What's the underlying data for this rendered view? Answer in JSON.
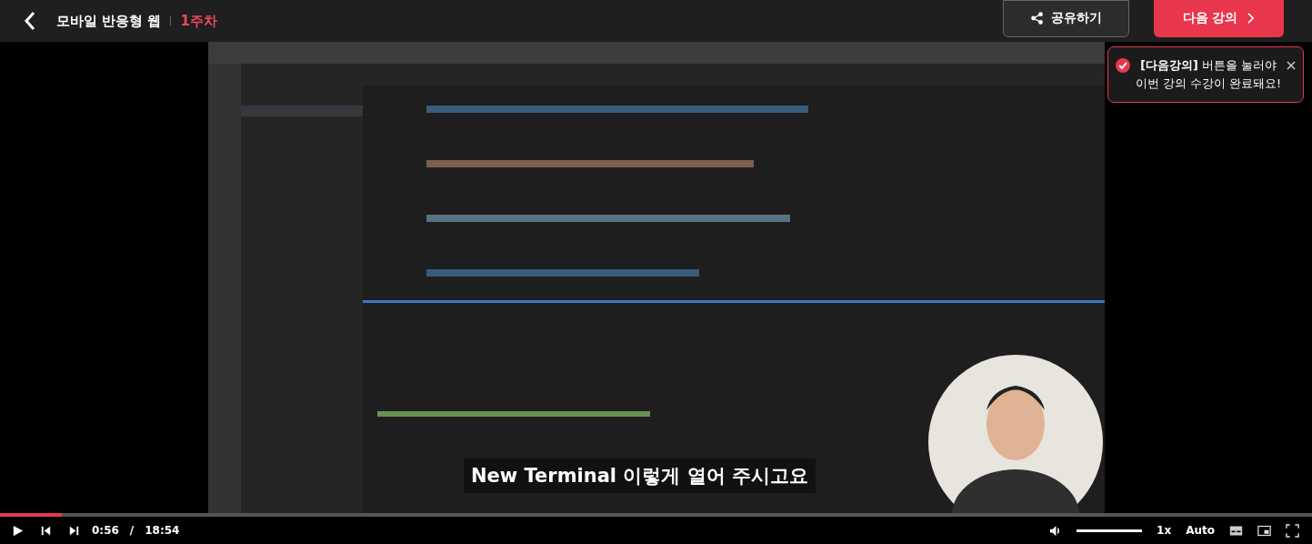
{
  "header": {
    "course": "모바일 반응형 웹",
    "section": "1주차",
    "share_button": "공유하기",
    "next_button": "다음 강의"
  },
  "toast": {
    "bold": "[다음강의]",
    "message": "버튼을 눌러야 이번 강의 수강이 완료돼요!"
  },
  "video": {
    "subtitle": "New Terminal 이렇게 열어 주시고요"
  },
  "player": {
    "progress": {
      "level": 0.047
    },
    "current_time": "0:56",
    "separator": "/",
    "duration": "18:54",
    "volume": {
      "level": 1
    },
    "speed": "1x",
    "quality": "Auto",
    "playing": false
  }
}
